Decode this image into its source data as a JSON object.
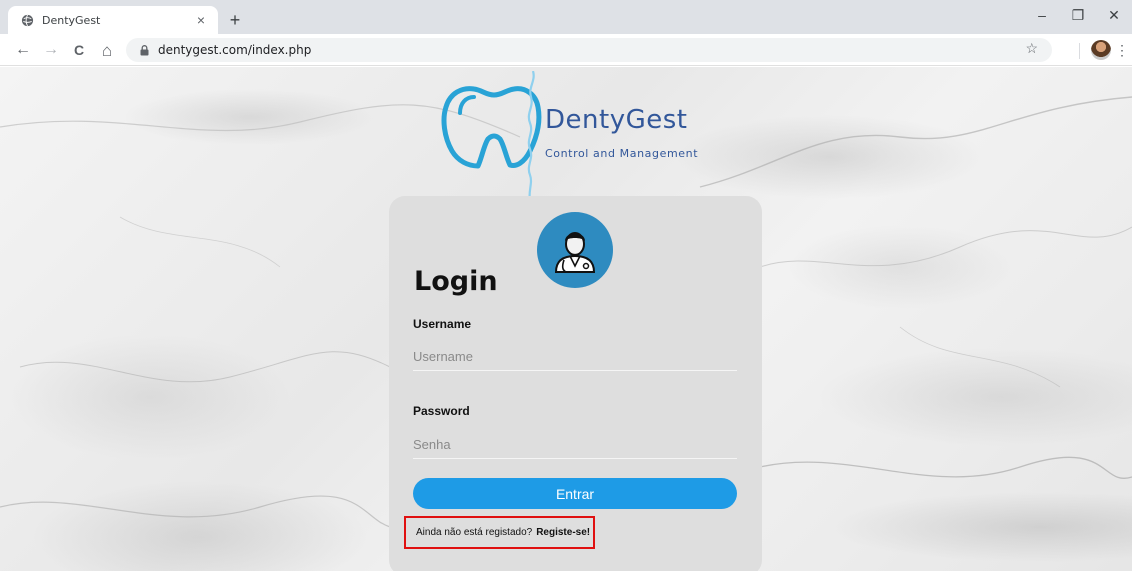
{
  "browser": {
    "tab_title": "DentyGest",
    "tab_close": "×",
    "new_tab": "+",
    "url": "dentygest.com/index.php",
    "back": "←",
    "forward": "→",
    "reload": "C",
    "home": "⌂",
    "star": "☆",
    "menu": "⋮",
    "minimize": "–",
    "restore": "❐",
    "close": "✕"
  },
  "logo": {
    "name": "DentyGest",
    "tagline": "Control and Management",
    "color": "#32579a",
    "tooth_color": "#29a3d6"
  },
  "login": {
    "title": "Login",
    "username_label": "Username",
    "username_placeholder": "Username",
    "password_label": "Password",
    "password_placeholder": "Senha",
    "submit_label": "Entrar",
    "register_prompt": "Ainda não está registado?",
    "register_link": "Registe-se!",
    "button_color": "#1e9be6",
    "highlight_color": "#e01010"
  }
}
